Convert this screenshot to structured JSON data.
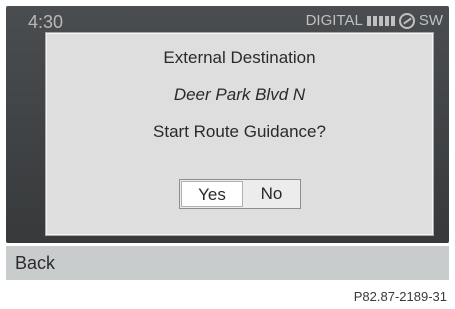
{
  "status": {
    "time": "4:30",
    "mode_label": "DIGITAL",
    "compass_heading": "SW",
    "icons": [
      "signal-strength-icon",
      "compass-icon"
    ]
  },
  "dialog": {
    "title": "External Destination",
    "destination": "Deer Park Blvd N",
    "question": "Start Route Guidance?",
    "yes_label": "Yes",
    "no_label": "No",
    "selected": "Yes"
  },
  "footer": {
    "back_label": "Back"
  },
  "figure_ref": "P82.87-2189-31",
  "colors": {
    "display_bg": "#444749",
    "dialog_bg": "#dedede",
    "backbar_bg": "#c9cccd"
  }
}
